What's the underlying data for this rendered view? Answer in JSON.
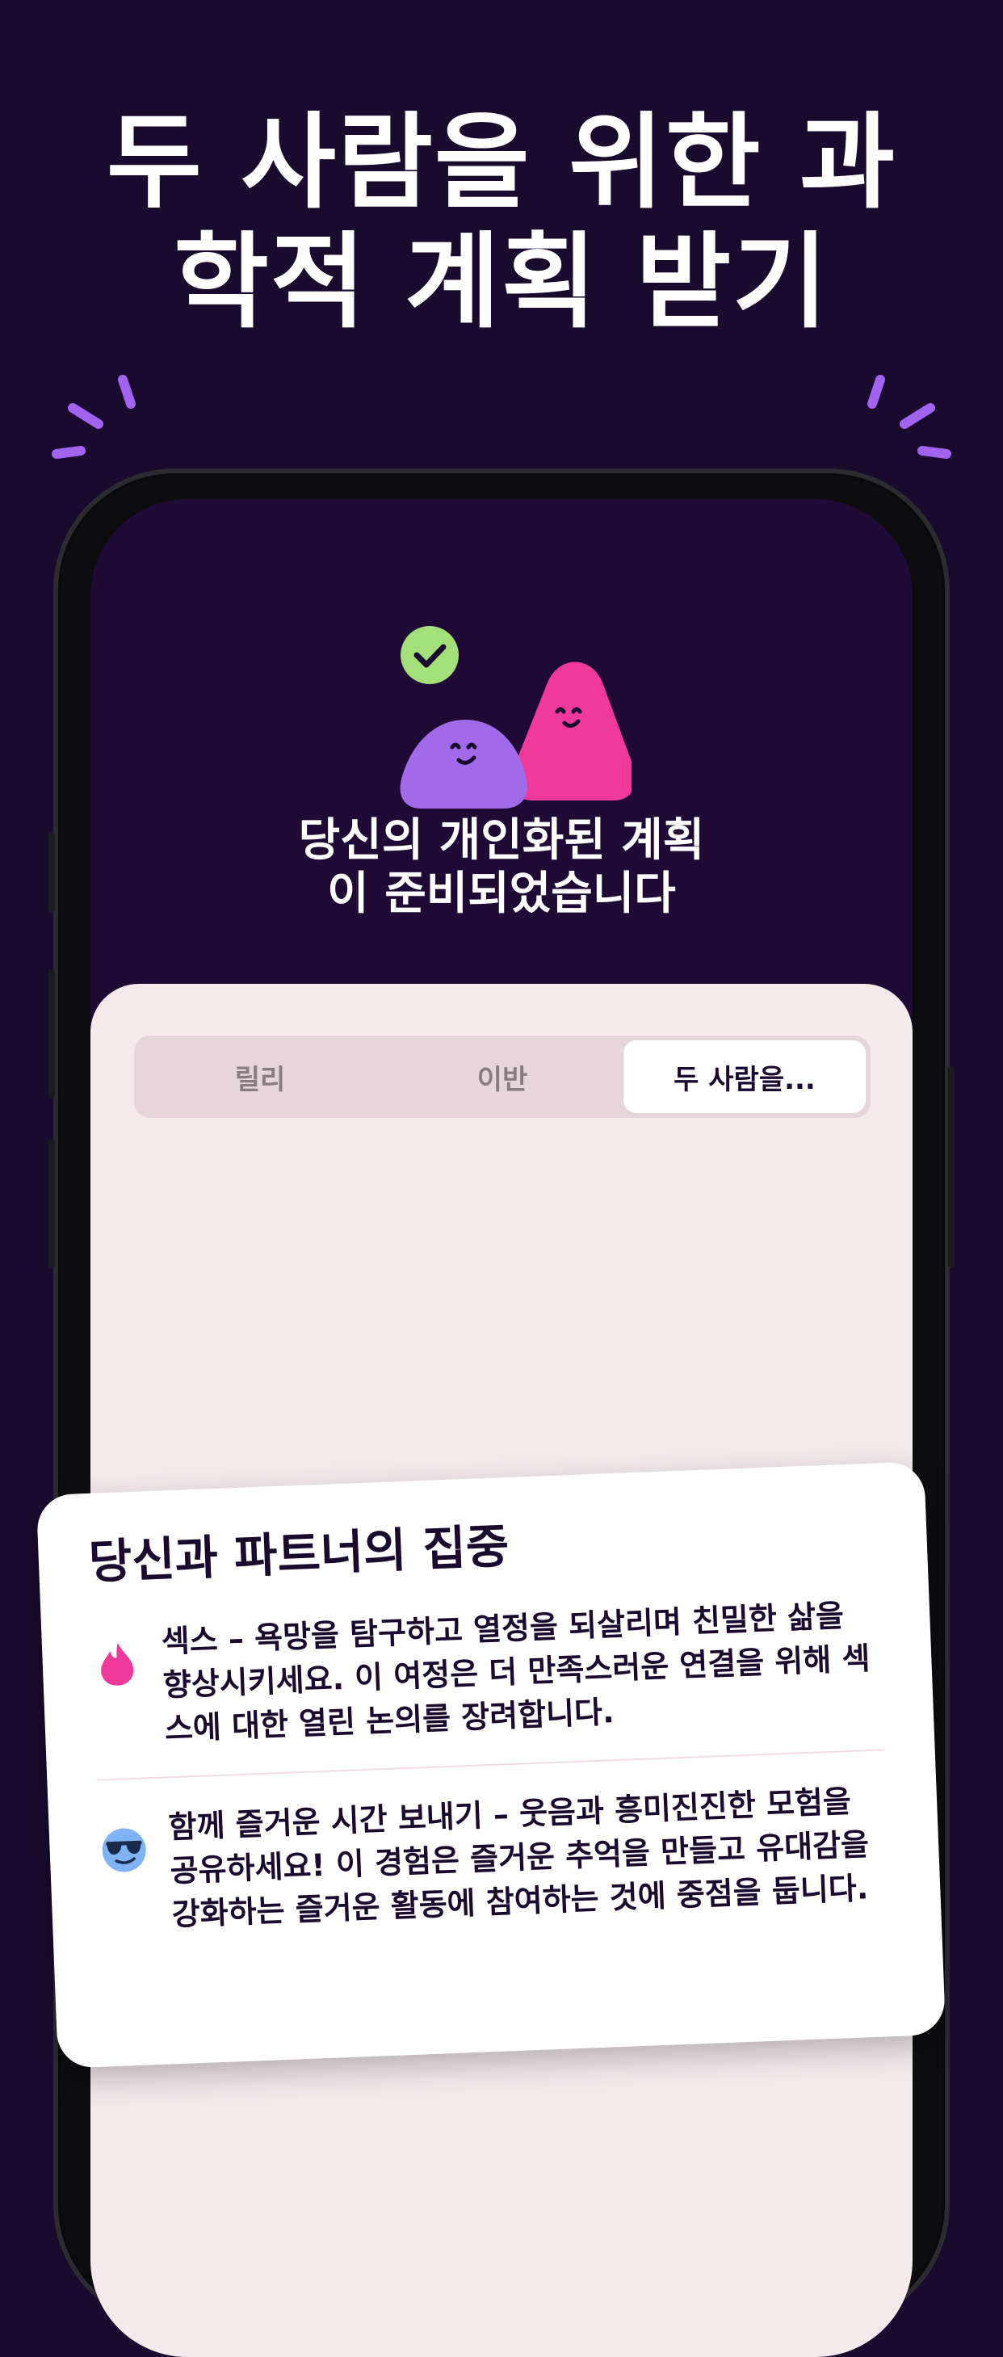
{
  "headline": {
    "line1": "두 사람을 위한 과",
    "line2": "학적 계획 받기"
  },
  "plan": {
    "title_line1": "당신의 개인화된 계획",
    "title_line2": "이 준비되었습니다"
  },
  "tabs": [
    {
      "label": "릴리",
      "active": false
    },
    {
      "label": "이반",
      "active": false
    },
    {
      "label": "두 사람을...",
      "active": true
    }
  ],
  "focus_card": {
    "title": "당신과 파트너의 집중",
    "items": [
      {
        "icon": "pink-flame-icon",
        "text": "섹스 – 욕망을 탐구하고 열정을 되살리며 친밀한 삶을 향상시키세요. 이 여정은 더 만족스러운 연결을 위해 섹스에 대한 열린 논의를 장려합니다."
      },
      {
        "icon": "sunglasses-face-icon",
        "text": "함께 즐거운 시간 보내기 – 웃음과 흥미진진한 모험을 공유하세요! 이 경험은 즐거운 추억을 만들고 유대감을 강화하는 즐거운 활동에 참여하는 것에 중점을 둡니다."
      }
    ]
  },
  "colors": {
    "background": "#1a0a2e",
    "accent_purple": "#a06ae8",
    "accent_pink": "#f0399a",
    "check_green": "#a3e07a",
    "sheet": "#f5e9ec"
  }
}
